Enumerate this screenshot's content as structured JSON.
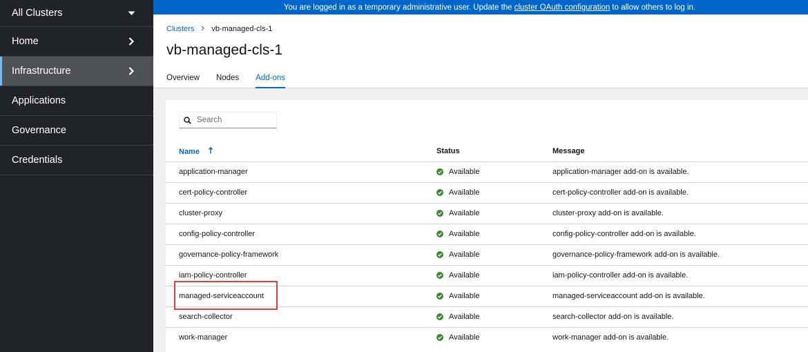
{
  "sidebar": {
    "items": [
      {
        "label": "All Clusters",
        "chevron": "down"
      },
      {
        "label": "Home",
        "chevron": "right"
      },
      {
        "label": "Infrastructure",
        "chevron": "right",
        "active": true
      },
      {
        "label": "Applications"
      },
      {
        "label": "Governance"
      },
      {
        "label": "Credentials"
      }
    ]
  },
  "banner": {
    "text_before": "You are logged in as a temporary administrative user. Update the",
    "link": "cluster OAuth configuration",
    "text_after": "to allow others to log in."
  },
  "breadcrumb": {
    "parent": "Clusters",
    "current": "vb-managed-cls-1"
  },
  "page_title": "vb-managed-cls-1",
  "tabs": [
    "Overview",
    "Nodes",
    "Add-ons"
  ],
  "search": {
    "placeholder": "Search"
  },
  "table": {
    "headers": {
      "name": "Name",
      "status": "Status",
      "message": "Message"
    },
    "rows": [
      {
        "name": "application-manager",
        "status": "Available",
        "message": "application-manager add-on is available."
      },
      {
        "name": "cert-policy-controller",
        "status": "Available",
        "message": "cert-policy-controller add-on is available."
      },
      {
        "name": "cluster-proxy",
        "status": "Available",
        "message": "cluster-proxy add-on is available."
      },
      {
        "name": "config-policy-controller",
        "status": "Available",
        "message": "config-policy-controller add-on is available."
      },
      {
        "name": "governance-policy-framework",
        "status": "Available",
        "message": "governance-policy-framework add-on is available."
      },
      {
        "name": "iam-policy-controller",
        "status": "Available",
        "message": "iam-policy-controller add-on is available."
      },
      {
        "name": "managed-serviceaccount",
        "status": "Available",
        "message": "managed-serviceaccount add-on is available."
      },
      {
        "name": "search-collector",
        "status": "Available",
        "message": "search-collector add-on is available."
      },
      {
        "name": "work-manager",
        "status": "Available",
        "message": "work-manager add-on is available."
      }
    ]
  },
  "colors": {
    "accent": "#0066cc",
    "success": "#3e8635",
    "sidebar_bg": "#212427",
    "highlight": "#e0403a"
  }
}
